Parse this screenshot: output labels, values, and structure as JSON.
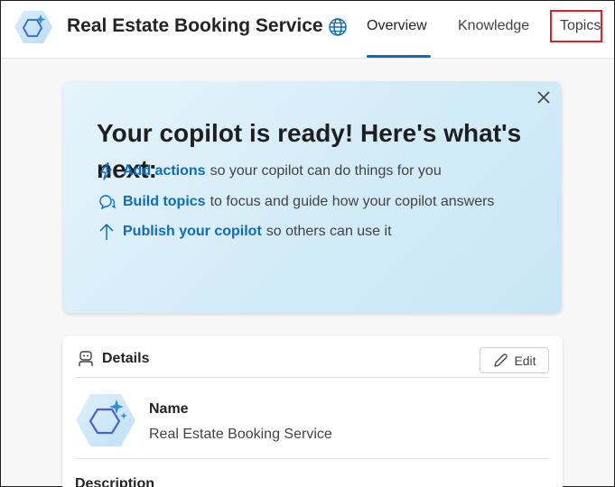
{
  "header": {
    "app_title": "Real Estate Booking Service",
    "app_icon": "copilot-hex-icon",
    "globe_icon": "globe-icon",
    "tabs": [
      {
        "label": "Overview",
        "active": true
      },
      {
        "label": "Knowledge",
        "active": false
      },
      {
        "label": "Topics",
        "active": false,
        "highlighted": true
      }
    ],
    "accent_color": "#0f6cbd",
    "highlight_color": "#e0202a"
  },
  "banner": {
    "title": "Your copilot is ready! Here's what's next:",
    "close_icon": "close-icon",
    "items": [
      {
        "icon": "lightning-icon",
        "link": "Add actions",
        "text": "so your copilot can do things for you"
      },
      {
        "icon": "chat-bubbles-icon",
        "link": "Build topics",
        "text": "to focus and guide how your copilot answers"
      },
      {
        "icon": "arrow-up-icon",
        "link": "Publish your copilot",
        "text": "so others can use it"
      }
    ]
  },
  "details": {
    "title": "Details",
    "icon": "bot-icon",
    "edit_label": "Edit",
    "edit_icon": "pencil-icon",
    "name_label": "Name",
    "name_value": "Real Estate Booking Service",
    "description_label": "Description"
  }
}
